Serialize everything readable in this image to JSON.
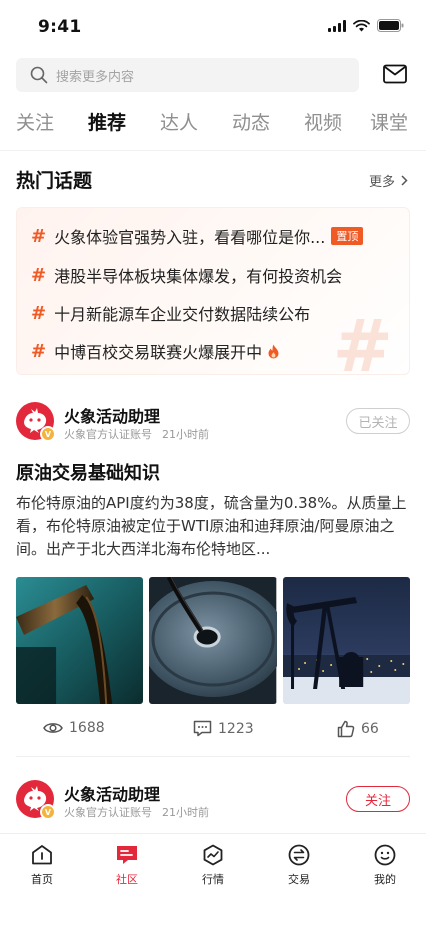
{
  "status_bar": {
    "time": "9:41"
  },
  "search": {
    "placeholder": "搜索更多内容"
  },
  "tabs": [
    {
      "label": "关注",
      "active": false
    },
    {
      "label": "推荐",
      "active": true
    },
    {
      "label": "达人",
      "active": false
    },
    {
      "label": "动态",
      "active": false
    },
    {
      "label": "视频",
      "active": false
    },
    {
      "label": "课堂",
      "active": false
    }
  ],
  "hot_topics": {
    "title": "热门话题",
    "more_label": "更多",
    "items": [
      {
        "hash": "#",
        "text": "火象体验官强势入驻，看看哪位是你...",
        "badge": "置顶"
      },
      {
        "hash": "#",
        "text": "港股半导体板块集体爆发，有何投资机会"
      },
      {
        "hash": "#",
        "text": "十月新能源车企业交付数据陆续公布"
      },
      {
        "hash": "#",
        "text": "中博百校交易联赛火爆展开中",
        "icon": "fire-icon"
      }
    ]
  },
  "posts": [
    {
      "author": "火象活动助理",
      "verified_label": "火象官方认证账号",
      "time": "21小时前",
      "follow_label": "已关注",
      "followed": true,
      "title": "原油交易基础知识",
      "body": "布伦特原油的API度约为38度，硫含量为0.38%。从质量上看，布伦特原油被定位于WTI原油和迪拜原油/阿曼原油之间。出产于北大西洋北海布伦特地区...",
      "photos": [
        "oil-pouring-photo",
        "oil-barrel-photo",
        "oil-pumpjack-photo"
      ],
      "views": "1688",
      "comments": "1223",
      "likes": "66"
    },
    {
      "author": "火象活动助理",
      "verified_label": "火象官方认证账号",
      "time": "21小时前",
      "follow_label": "关注",
      "followed": false
    }
  ],
  "tabbar": [
    {
      "label": "首页",
      "icon": "home-icon",
      "active": false
    },
    {
      "label": "社区",
      "icon": "community-icon",
      "active": true
    },
    {
      "label": "行情",
      "icon": "market-icon",
      "active": false
    },
    {
      "label": "交易",
      "icon": "trade-icon",
      "active": false
    },
    {
      "label": "我的",
      "icon": "profile-icon",
      "active": false
    }
  ],
  "colors": {
    "accent": "#e3283c",
    "topic_hash": "#ef5a25",
    "verified": "#f3b33d"
  }
}
